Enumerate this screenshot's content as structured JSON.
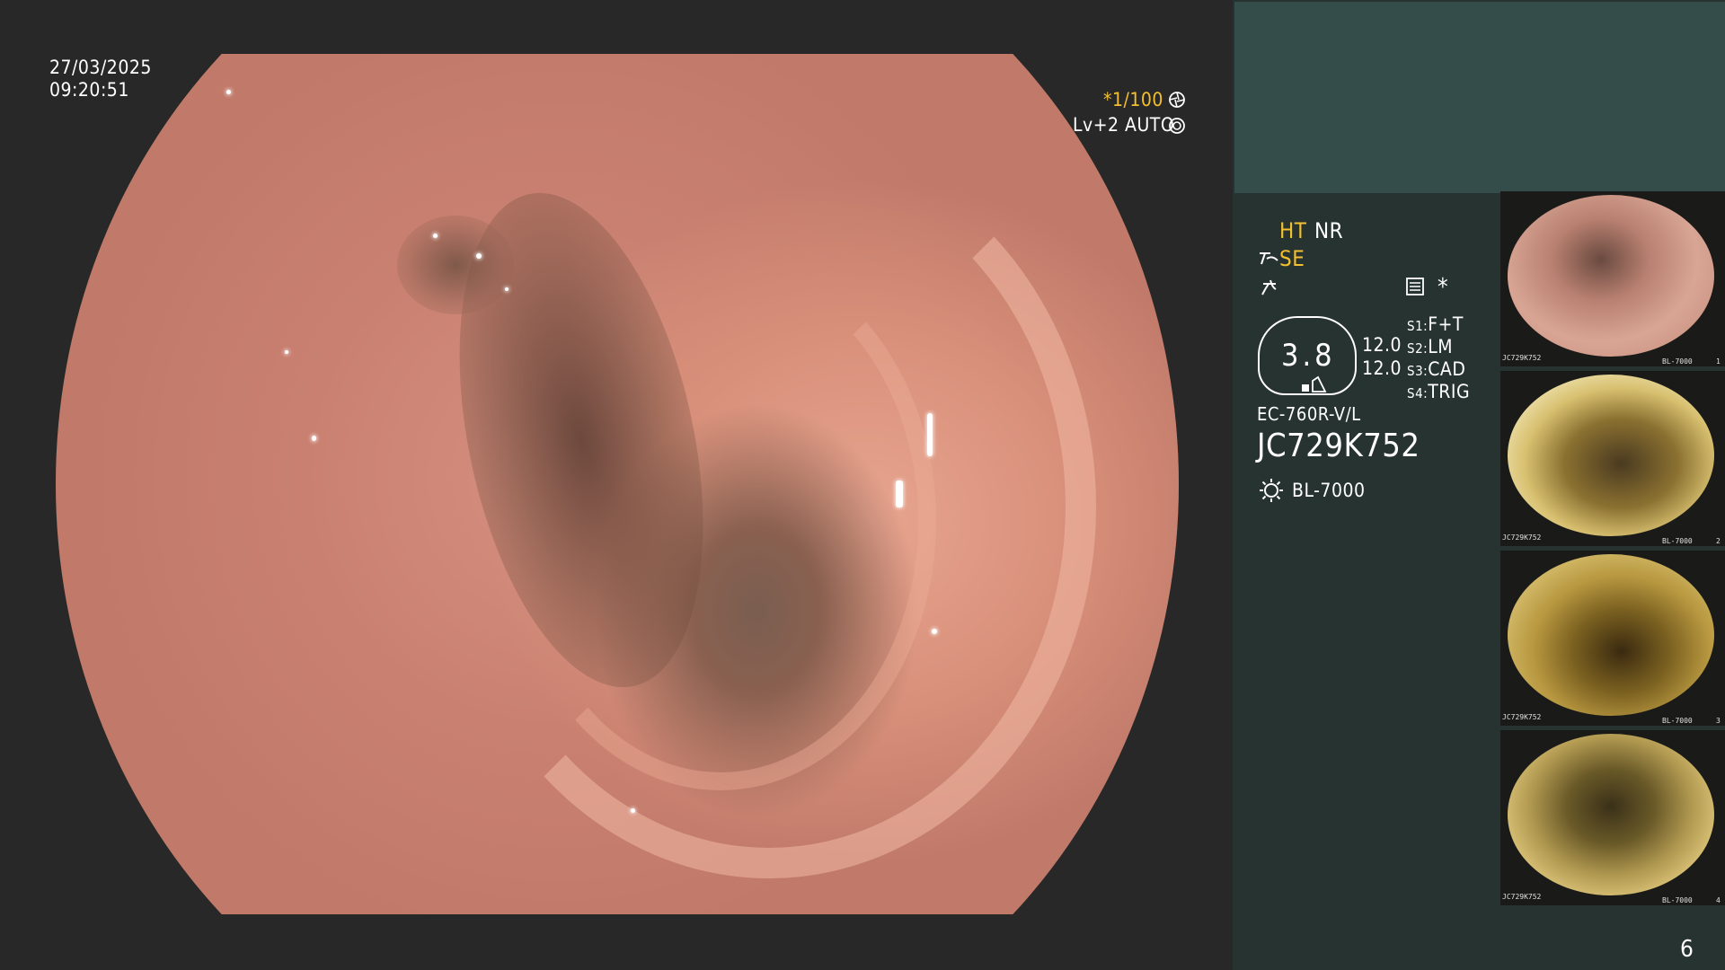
{
  "main": {
    "date": "27/03/2025",
    "time": "09:20:51",
    "shutter": "*1/100",
    "level": "Lv+2 AUTO",
    "icons": [
      "shutter-icon",
      "auto-iris-icon"
    ]
  },
  "panel": {
    "mode_ht": "HT",
    "mode_nr": "NR",
    "mode_se": "SE",
    "gauge_value": "3.8",
    "gauge_upper": "12.0",
    "gauge_lower": "12.0",
    "switches": [
      {
        "key": "S1",
        "value": "F+T"
      },
      {
        "key": "S2",
        "value": "LM"
      },
      {
        "key": "S3",
        "value": "CAD"
      },
      {
        "key": "S4",
        "value": "TRIG"
      }
    ],
    "scope_model": "EC-760R-V/L",
    "serial": "JC729K752",
    "light_source": "BL-7000",
    "asterisk": "*",
    "page_number": "6"
  },
  "thumbnails": [
    {
      "serial": "JC729K752",
      "src_label": "BL-7000",
      "index": "1"
    },
    {
      "serial": "JC729K752",
      "src_label": "BL-7000",
      "index": "2"
    },
    {
      "serial": "JC729K752",
      "src_label": "BL-7000",
      "index": "3"
    },
    {
      "serial": "JC729K752",
      "src_label": "BL-7000",
      "index": "4"
    }
  ],
  "colors": {
    "accent_yellow": "#f4c030",
    "panel_bg": "#273330",
    "panel_header": "#344d4a"
  }
}
